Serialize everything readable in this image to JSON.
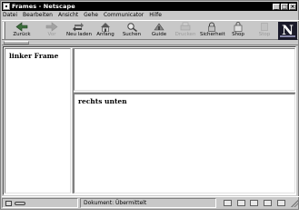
{
  "window": {
    "title": "Frames - Netscape"
  },
  "menubar": {
    "items": [
      "Datei",
      "Bearbeiten",
      "Ansicht",
      "Gehe",
      "Communicator",
      "Hilfe"
    ]
  },
  "toolbar": {
    "buttons": [
      {
        "label": "Zurück",
        "icon": "back-arrow-icon",
        "enabled": true
      },
      {
        "label": "Vor",
        "icon": "forward-arrow-icon",
        "enabled": false
      },
      {
        "label": "Neu laden",
        "icon": "reload-icon",
        "enabled": true
      },
      {
        "label": "Anfang",
        "icon": "home-icon",
        "enabled": true
      },
      {
        "label": "Suchen",
        "icon": "search-icon",
        "enabled": true
      },
      {
        "label": "Guide",
        "icon": "guide-icon",
        "enabled": true
      },
      {
        "label": "Drucken",
        "icon": "print-icon",
        "enabled": false
      },
      {
        "label": "Sicherheit",
        "icon": "security-lock-icon",
        "enabled": true
      },
      {
        "label": "Shop",
        "icon": "shop-bag-icon",
        "enabled": true
      },
      {
        "label": "Stop",
        "icon": "stop-icon",
        "enabled": false
      }
    ],
    "logo": "N"
  },
  "frames": {
    "left_heading": "linker Frame",
    "top_heading": "",
    "bottom_heading": "rechts unten"
  },
  "statusbar": {
    "text": "Dokument: Übermittelt"
  },
  "colors": {
    "chrome": "#c8c8c8",
    "titlebar": "#000000",
    "content_bg": "#ffffff"
  }
}
